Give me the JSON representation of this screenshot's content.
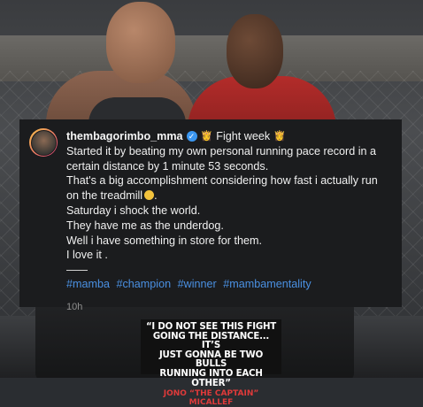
{
  "post": {
    "username": "thembagorimbo_mma",
    "verified_icon": "verified-badge-icon",
    "crown_emoji": "👸",
    "title": "Fight week",
    "lines": [
      "Started it by beating my own personal running pace record in a",
      "certain distance by 1 minute 53 seconds.",
      "That's a big accomplishment considering how fast i actually run",
      "on the treadmill",
      "Saturday i shock the world.",
      "They have me as the underdog.",
      "Well i have something in store for them.",
      "I love it ."
    ],
    "emoji_after_treadmill": "grinning-face-icon",
    "hashtags": [
      "#mamba",
      "#champion",
      "#winner",
      "#mambamentality"
    ],
    "time": "10h"
  },
  "quote": {
    "text_lines": [
      "“I DO NOT SEE THIS FIGHT",
      "GOING THE DISTANCE... IT’S",
      "JUST GONNA BE TWO BULLS",
      "RUNNING INTO EACH OTHER”"
    ],
    "author": "JONO “THE CAPTAIN” MICALLEF"
  },
  "colors": {
    "hashtag": "#4a90e2",
    "verified": "#3a96f0",
    "caption_bg": "#1b1c1e",
    "quote_author": "#e03a3a"
  }
}
